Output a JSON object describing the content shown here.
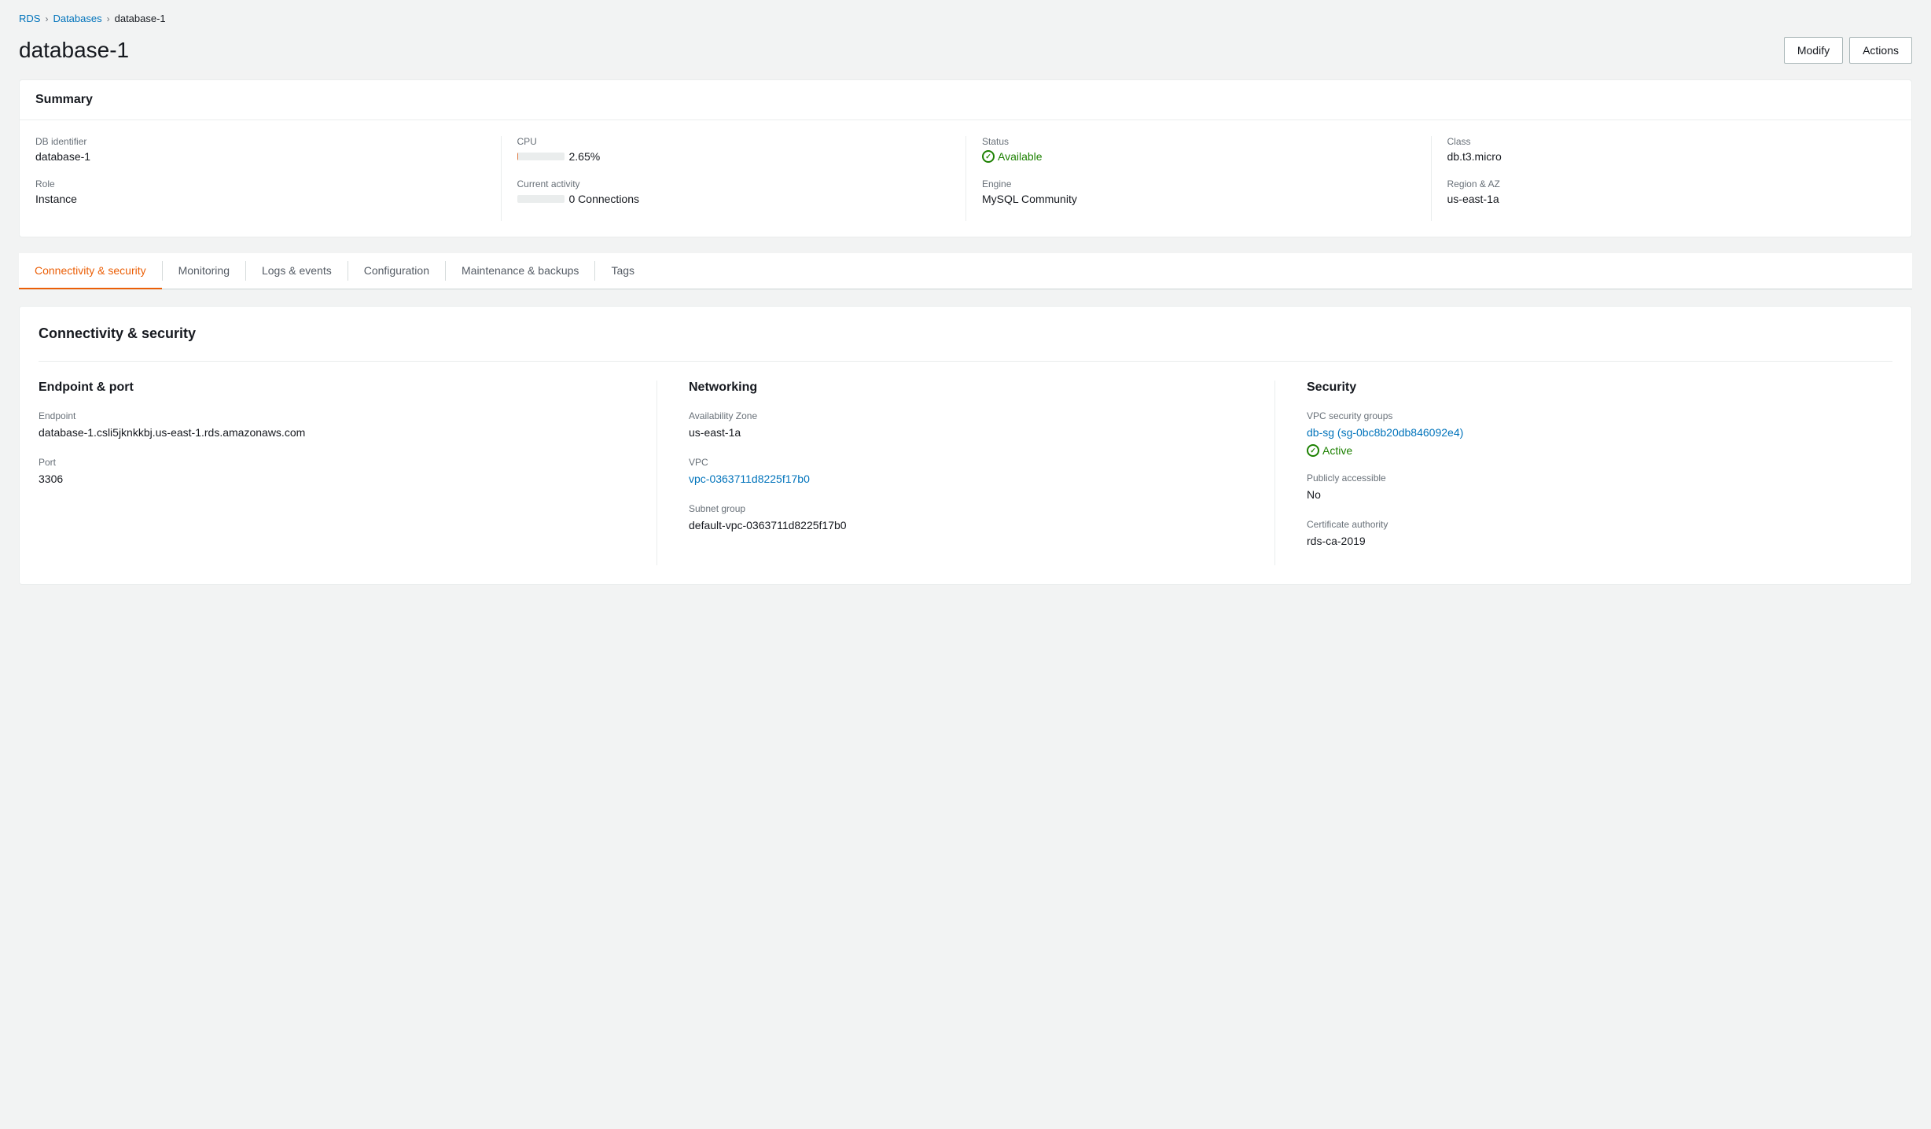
{
  "breadcrumb": {
    "items": [
      {
        "label": "RDS",
        "id": "rds"
      },
      {
        "label": "Databases",
        "id": "databases"
      },
      {
        "label": "database-1",
        "id": "database-1"
      }
    ]
  },
  "page": {
    "title": "database-1"
  },
  "header": {
    "modify_label": "Modify",
    "actions_label": "Actions"
  },
  "summary": {
    "title": "Summary",
    "db_identifier_label": "DB identifier",
    "db_identifier_value": "database-1",
    "role_label": "Role",
    "role_value": "Instance",
    "cpu_label": "CPU",
    "cpu_value": "2.65%",
    "cpu_percent": 2.65,
    "current_activity_label": "Current activity",
    "current_activity_value": "0 Connections",
    "status_label": "Status",
    "status_value": "Available",
    "engine_label": "Engine",
    "engine_value": "MySQL Community",
    "class_label": "Class",
    "class_value": "db.t3.micro",
    "region_az_label": "Region & AZ",
    "region_az_value": "us-east-1a"
  },
  "tabs": [
    {
      "label": "Connectivity & security",
      "id": "connectivity",
      "active": true
    },
    {
      "label": "Monitoring",
      "id": "monitoring",
      "active": false
    },
    {
      "label": "Logs & events",
      "id": "logs",
      "active": false
    },
    {
      "label": "Configuration",
      "id": "configuration",
      "active": false
    },
    {
      "label": "Maintenance & backups",
      "id": "maintenance",
      "active": false
    },
    {
      "label": "Tags",
      "id": "tags",
      "active": false
    }
  ],
  "connectivity_security": {
    "title": "Connectivity & security",
    "endpoint_port": {
      "section_title": "Endpoint & port",
      "endpoint_label": "Endpoint",
      "endpoint_value": "database-1.csli5jknkkbj.us-east-1.rds.amazonaws.com",
      "port_label": "Port",
      "port_value": "3306"
    },
    "networking": {
      "section_title": "Networking",
      "availability_zone_label": "Availability Zone",
      "availability_zone_value": "us-east-1a",
      "vpc_label": "VPC",
      "vpc_value": "vpc-0363711d8225f17b0",
      "subnet_group_label": "Subnet group",
      "subnet_group_value": "default-vpc-0363711d8225f17b0"
    },
    "security": {
      "section_title": "Security",
      "vpc_security_groups_label": "VPC security groups",
      "vpc_security_groups_value": "db-sg (sg-0bc8b20db846092e4)",
      "vpc_security_status": "Active",
      "publicly_accessible_label": "Publicly accessible",
      "publicly_accessible_value": "No",
      "certificate_authority_label": "Certificate authority",
      "certificate_authority_value": "rds-ca-2019"
    }
  }
}
